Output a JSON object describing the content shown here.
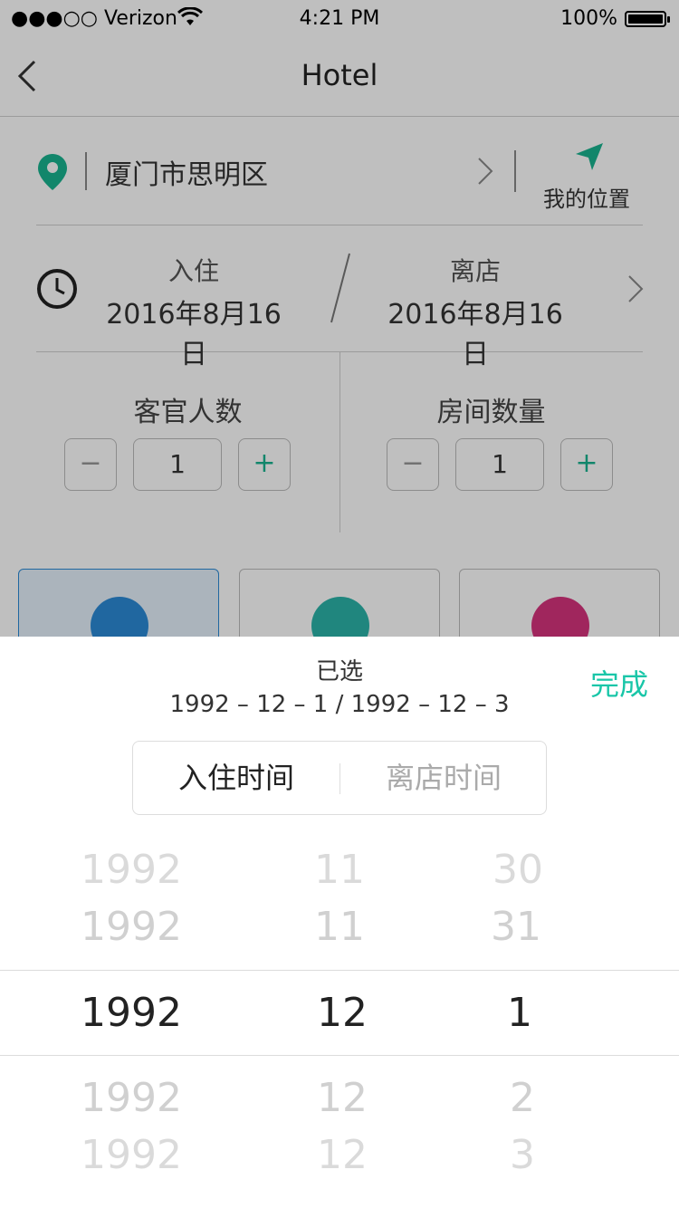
{
  "status_bar": {
    "carrier": "●●●○○ Verizon",
    "time": "4:21 PM",
    "battery_percent": "100%"
  },
  "nav": {
    "title": "Hotel"
  },
  "location": {
    "text": "厦门市思明区",
    "my_location_label": "我的位置"
  },
  "dates": {
    "checkin_label": "入住",
    "checkin_date": "2016年8月16日",
    "checkout_label": "离店",
    "checkout_date": "2016年8月16日"
  },
  "guests": {
    "label": "客官人数",
    "value": "1",
    "minus": "−",
    "plus": "+"
  },
  "rooms": {
    "label": "房间数量",
    "value": "1",
    "minus": "−",
    "plus": "+"
  },
  "picker_sheet": {
    "selected_title": "已选",
    "selected_range": "1992 – 12 – 1  /  1992 – 12 – 3",
    "done_label": "完成",
    "tabs": [
      "入住时间",
      "离店时间"
    ],
    "years": [
      "1992",
      "1992",
      "1992",
      "1992",
      "1992"
    ],
    "months": [
      "11",
      "11",
      "12",
      "12",
      "12"
    ],
    "days": [
      "30",
      "31",
      "1",
      "2",
      "3"
    ]
  },
  "colors": {
    "accent": "#19c6a8",
    "blue": "#2b8ad6",
    "teal": "#2bb3a9",
    "pink": "#d6337d"
  }
}
